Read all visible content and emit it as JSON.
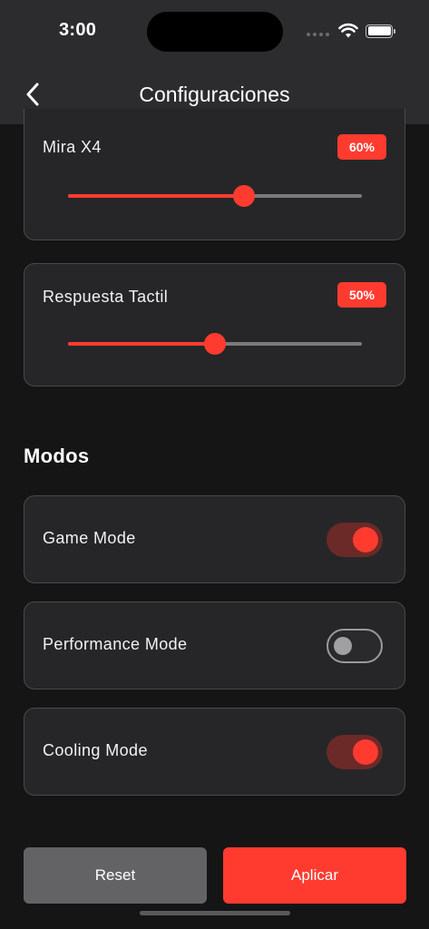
{
  "status_bar": {
    "time": "3:00"
  },
  "header": {
    "title": "Configuraciones"
  },
  "sliders": [
    {
      "label": "Mira X4",
      "value_label": "60%",
      "value": 0.6
    },
    {
      "label": "Respuesta Tactil",
      "value_label": "50%",
      "value": 0.5
    }
  ],
  "modes_section": {
    "title": "Modos",
    "items": [
      {
        "label": "Game Mode",
        "enabled": true
      },
      {
        "label": "Performance Mode",
        "enabled": false
      },
      {
        "label": "Cooling Mode",
        "enabled": true
      }
    ]
  },
  "actions": {
    "reset_label": "Reset",
    "apply_label": "Aplicar"
  },
  "colors": {
    "accent": "#ff3b30",
    "background": "#151515",
    "card": "#262628",
    "header": "#2c2c2e"
  },
  "icons": {
    "back": "chevron-left-icon",
    "wifi": "wifi-icon",
    "battery": "battery-icon"
  }
}
